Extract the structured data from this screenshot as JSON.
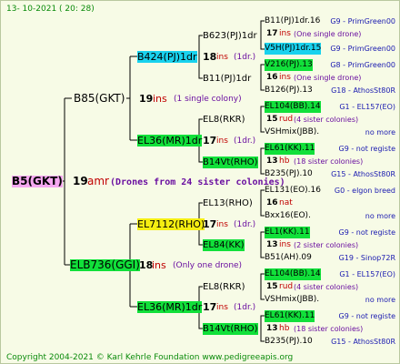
{
  "header": {
    "date": "13- 10-2021 ( 20: 28)"
  },
  "root": {
    "name": "B5(GKT)",
    "year": "19",
    "suffix": "amr",
    "note": "(Drones from 24 sister colonies)"
  },
  "gen1": [
    {
      "name": "B85(GKT)",
      "year": "19",
      "suffix": "ins",
      "note": "(1 single colony)"
    },
    {
      "name": "ELB736(GGI)",
      "year": "18",
      "suffix": "ins",
      "note": "(Only one drone)"
    }
  ],
  "gen2": [
    {
      "name": "B424(PJ)1dr",
      "year": "18",
      "suffix": "ins",
      "note": "(1dr.)"
    },
    {
      "name": "EL36(MR)1dr",
      "year": "17",
      "suffix": "ins",
      "note": "(1dr.)"
    },
    {
      "name": "EL7112(RHO)",
      "year": "17",
      "suffix": "ins",
      "note": "(1dr.)"
    },
    {
      "name": "EL36(MR)1dr",
      "year": "17",
      "suffix": "ins",
      "note": "(1dr.)"
    }
  ],
  "gen3": [
    {
      "name": "B623(PJ)1dr"
    },
    {
      "name": "B11(PJ)1dr"
    },
    {
      "name": "EL8(RKR)"
    },
    {
      "name": "B14Vt(RHO)"
    },
    {
      "name": "EL13(RHO)"
    },
    {
      "name": "EL84(KK)"
    },
    {
      "name": "EL8(RKR)"
    },
    {
      "name": "B14Vt(RHO)"
    }
  ],
  "gen4": [
    {
      "name": "B11(PJ)1dr.16",
      "year": "",
      "suffix": "",
      "note": "",
      "breeder": "G9 - PrimGreen00"
    },
    {
      "name": "",
      "year": "17",
      "suffix": "ins",
      "note": "(One single drone)",
      "breeder": ""
    },
    {
      "name": "V5H(PJ)1dr.15",
      "year": "",
      "suffix": "",
      "note": "",
      "breeder": "G9 - PrimGreen00"
    },
    {
      "name": "V216(PJ).13",
      "year": "",
      "suffix": "",
      "note": "",
      "breeder": "G8 - PrimGreen00"
    },
    {
      "name": "",
      "year": "16",
      "suffix": "ins",
      "note": "(One single drone)",
      "breeder": ""
    },
    {
      "name": "B126(PJ).13",
      "year": "",
      "suffix": "",
      "note": "",
      "breeder": "G18 - AthosSt80R"
    },
    {
      "name": "EL104(BB).14",
      "year": "",
      "suffix": "",
      "note": "",
      "breeder": "G1 - EL157(EO)"
    },
    {
      "name": "",
      "year": "15",
      "suffix": "rud",
      "note": "(4 sister colonies)",
      "breeder": ""
    },
    {
      "name": "VSHmix(JBB).",
      "year": "",
      "suffix": "",
      "note": "",
      "breeder": "no more"
    },
    {
      "name": "EL61(KK).11",
      "year": "",
      "suffix": "",
      "note": "",
      "breeder": "G9 - not registe"
    },
    {
      "name": "",
      "year": "13",
      "suffix": "hb",
      "note": "(18 sister colonies)",
      "breeder": ""
    },
    {
      "name": "B235(PJ).10",
      "year": "",
      "suffix": "",
      "note": "",
      "breeder": "G15 - AthosSt80R"
    },
    {
      "name": "EL131(EO).16",
      "year": "",
      "suffix": "",
      "note": "",
      "breeder": "G0 - elgon breed"
    },
    {
      "name": "",
      "year": "16",
      "suffix": "nat",
      "note": "",
      "breeder": ""
    },
    {
      "name": "Bxx16(EO).",
      "year": "",
      "suffix": "",
      "note": "",
      "breeder": "no more"
    },
    {
      "name": "EL1(KK).11",
      "year": "",
      "suffix": "",
      "note": "",
      "breeder": "G9 - not registe"
    },
    {
      "name": "",
      "year": "13",
      "suffix": "ins",
      "note": "(2 sister colonies)",
      "breeder": ""
    },
    {
      "name": "B51(AH).09",
      "year": "",
      "suffix": "",
      "note": "",
      "breeder": "G19 - Sinop72R"
    },
    {
      "name": "EL104(BB).14",
      "year": "",
      "suffix": "",
      "note": "",
      "breeder": "G1 - EL157(EO)"
    },
    {
      "name": "",
      "year": "15",
      "suffix": "rud",
      "note": "(4 sister colonies)",
      "breeder": ""
    },
    {
      "name": "VSHmix(JBB).",
      "year": "",
      "suffix": "",
      "note": "",
      "breeder": "no more"
    },
    {
      "name": "EL61(KK).11",
      "year": "",
      "suffix": "",
      "note": "",
      "breeder": "G9 - not registe"
    },
    {
      "name": "",
      "year": "13",
      "suffix": "hb",
      "note": "(18 sister colonies)",
      "breeder": ""
    },
    {
      "name": "B235(PJ).10",
      "year": "",
      "suffix": "",
      "note": "",
      "breeder": "G15 - AthosSt80R"
    }
  ],
  "footer": {
    "copyright": "Copyright 2004-2021 © Karl Kehrle Foundation   www.pedigreeapis.org"
  }
}
